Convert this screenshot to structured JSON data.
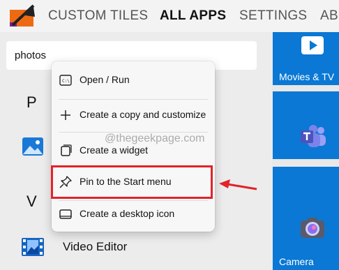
{
  "tabs": [
    {
      "label": "CUSTOM TILES"
    },
    {
      "label": "ALL APPS",
      "active": true
    },
    {
      "label": "SETTINGS"
    },
    {
      "label": "ABO"
    }
  ],
  "search": {
    "value": "photos"
  },
  "results": {
    "group_p": "P",
    "group_v": "V",
    "video_editor_label": "Video Editor"
  },
  "context_menu": {
    "items": [
      {
        "label": "Open / Run",
        "icon": "command-prompt-icon"
      },
      {
        "label": "Create a copy and customize",
        "icon": "plus-icon"
      },
      {
        "label": "Create a widget",
        "icon": "widget-icon"
      },
      {
        "label": "Pin to the Start menu",
        "icon": "pin-icon"
      },
      {
        "label": "Create a desktop icon",
        "icon": "desktop-icon"
      }
    ]
  },
  "tiles": [
    {
      "label": "Movies & TV",
      "icon": "play-icon"
    },
    {
      "label": "",
      "icon": "teams-icon"
    },
    {
      "label": "Camera",
      "icon": "camera-icon"
    }
  ],
  "watermark": "@thegeekpage.com",
  "colors": {
    "tile_blue": "#0a78d4",
    "highlight_red": "#e2232a"
  }
}
